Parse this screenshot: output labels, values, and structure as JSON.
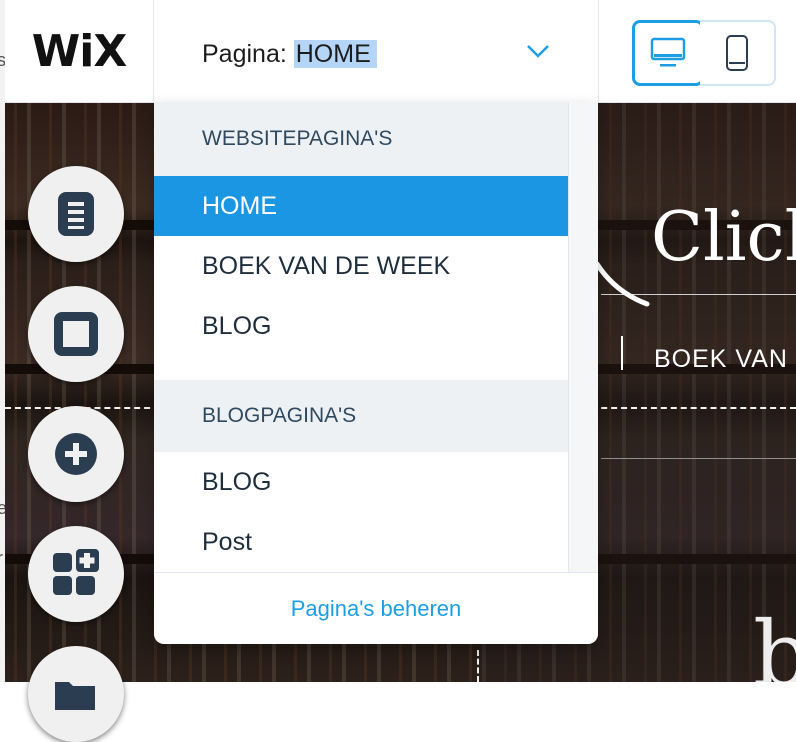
{
  "window": {
    "left_fragments": [
      "s",
      "e",
      "r"
    ]
  },
  "topbar": {
    "logo": "WiX",
    "page_label": "Pagina:",
    "page_value": "HOME",
    "devices": [
      "desktop-icon",
      "mobile-icon"
    ],
    "active_device": "desktop"
  },
  "dropdown": {
    "sections": [
      {
        "title": "WEBSITEPAGINA'S",
        "items": [
          "HOME",
          "BOEK VAN DE WEEK",
          "BLOG"
        ]
      },
      {
        "title": "BLOGPAGINA'S",
        "items": [
          "BLOG",
          "Post"
        ]
      }
    ],
    "selected": "HOME",
    "footer_link": "Pagina's beheren"
  },
  "canvas": {
    "heading_text": "Click",
    "menu_text": "BOEK VAN",
    "large_glyph": "b"
  },
  "tools": [
    "pages-icon",
    "background-icon",
    "add-icon",
    "app-market-icon",
    "media-folder-icon"
  ],
  "colors": {
    "accent": "#1b9ee3",
    "selected_bg": "#1a96e2",
    "section_bg": "#eef1f4",
    "tool_icon": "#2b3e51"
  }
}
